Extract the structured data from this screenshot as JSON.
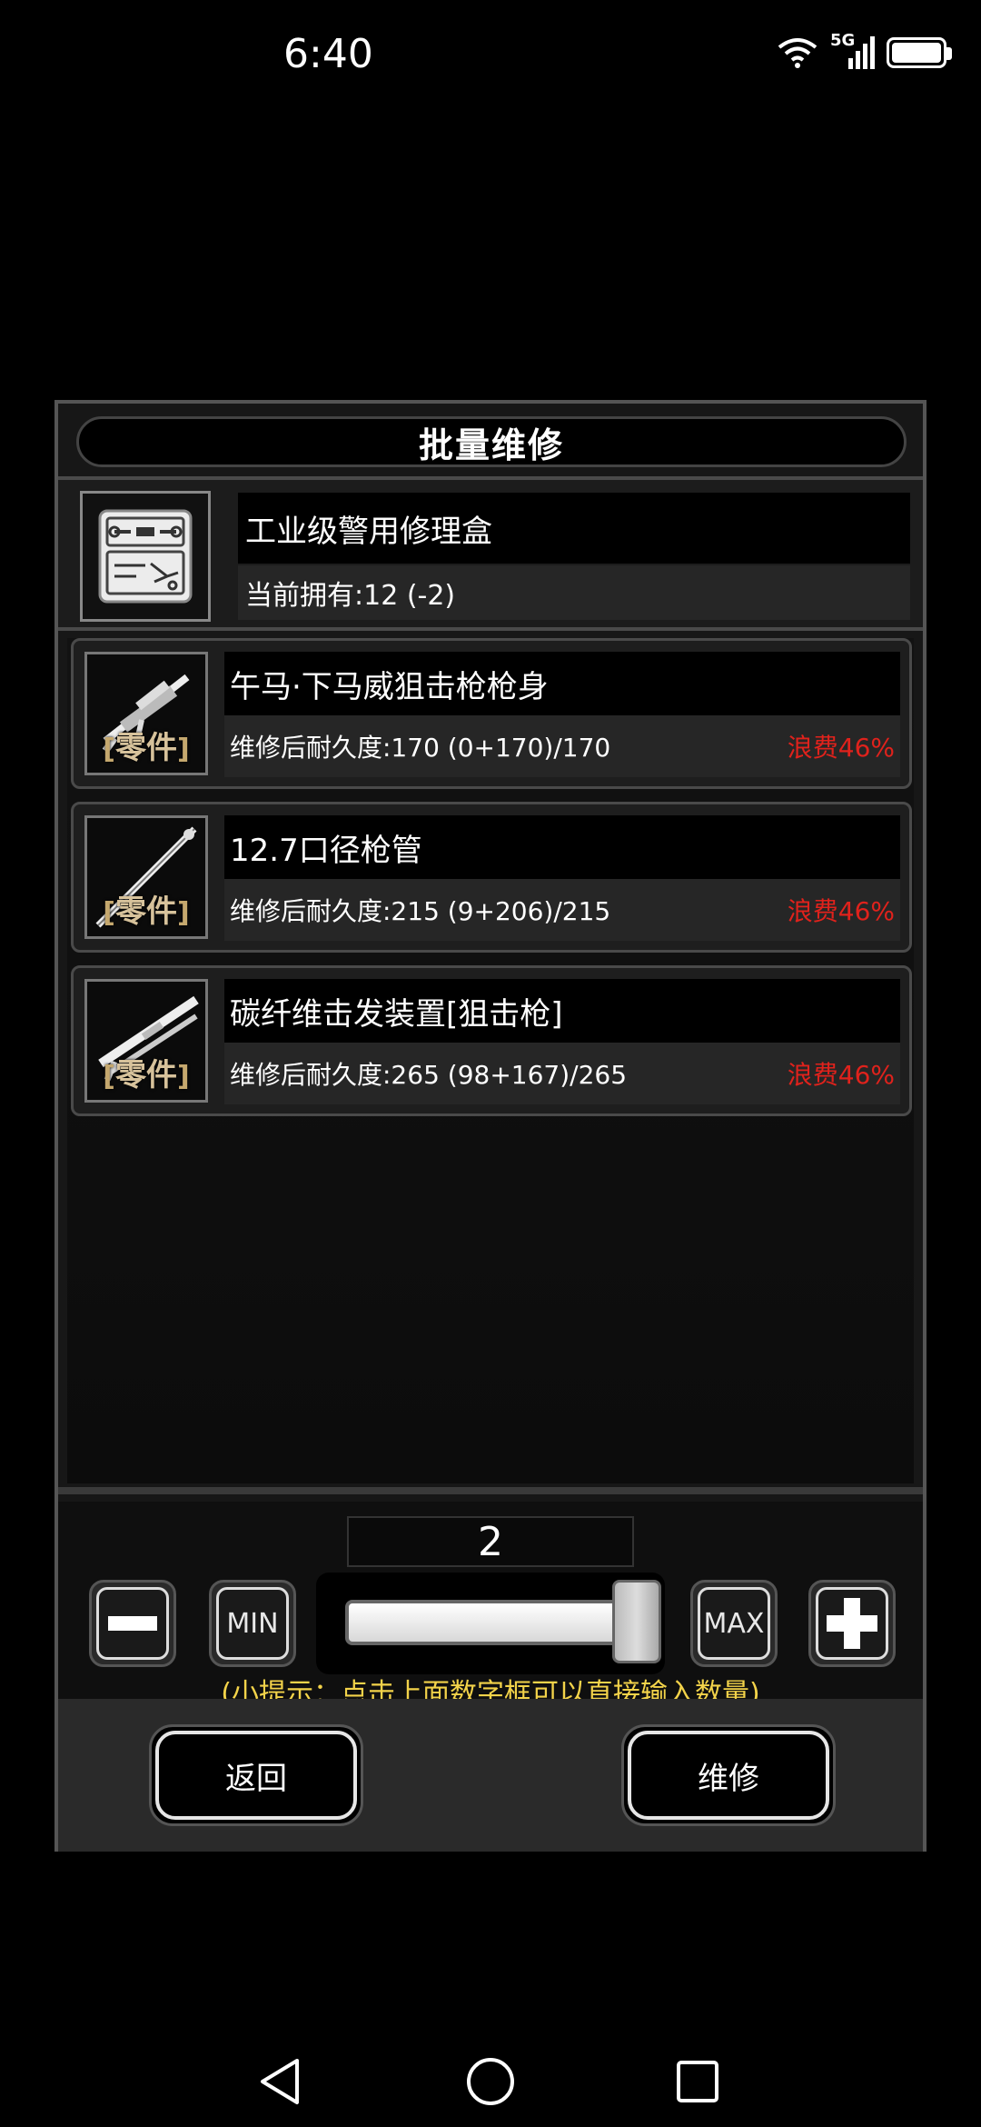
{
  "status_bar": {
    "time": "6:40",
    "network": "5G"
  },
  "dialog": {
    "title": "批量维修",
    "repair_kit": {
      "name": "工业级警用修理盒",
      "owned": "当前拥有:12 (-2)"
    },
    "items": [
      {
        "name": "午马·下马威狙击枪枪身",
        "durability": "维修后耐久度:170 (0+170)/170",
        "waste": "浪费46%",
        "tag": "零件"
      },
      {
        "name": "12.7口径枪管",
        "durability": "维修后耐久度:215 (9+206)/215",
        "waste": "浪费46%",
        "tag": "零件"
      },
      {
        "name": "碳纤维击发装置[狙击枪]",
        "durability": "维修后耐久度:265 (98+167)/265",
        "waste": "浪费46%",
        "tag": "零件"
      }
    ],
    "quantity": {
      "value": "2",
      "slider_fraction": 1.0,
      "min_label": "MIN",
      "max_label": "MAX"
    },
    "hint": "(小提示：点击上面数字框可以直接输入数量)",
    "back_label": "返回",
    "repair_label": "维修"
  },
  "colors": {
    "waste": "#e0221c",
    "hint": "#f3d34a"
  }
}
